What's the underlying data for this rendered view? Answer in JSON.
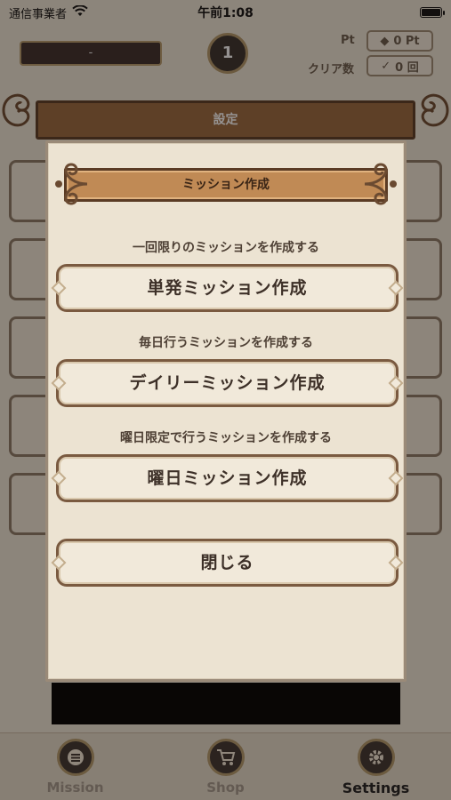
{
  "status_bar": {
    "carrier": "通信事業者",
    "time": "午前1:08"
  },
  "header": {
    "player_name": "-",
    "level": "1",
    "pt_label": "Pt",
    "pt_value": "0 Pt",
    "clear_label": "クリア数",
    "clear_value": "0 回"
  },
  "settings": {
    "title": "設定"
  },
  "modal": {
    "title": "ミッション作成",
    "sections": [
      {
        "description": "一回限りのミッションを作成する",
        "button_label": "単発ミッション作成"
      },
      {
        "description": "毎日行うミッションを作成する",
        "button_label": "デイリーミッション作成"
      },
      {
        "description": "曜日限定で行うミッションを作成する",
        "button_label": "曜日ミッション作成"
      }
    ],
    "close_label": "閉じる"
  },
  "tabbar": {
    "tabs": [
      {
        "label": "Mission",
        "icon": "list-icon"
      },
      {
        "label": "Shop",
        "icon": "cart-icon"
      },
      {
        "label": "Settings",
        "icon": "gear-icon"
      }
    ],
    "active": "Settings"
  }
}
